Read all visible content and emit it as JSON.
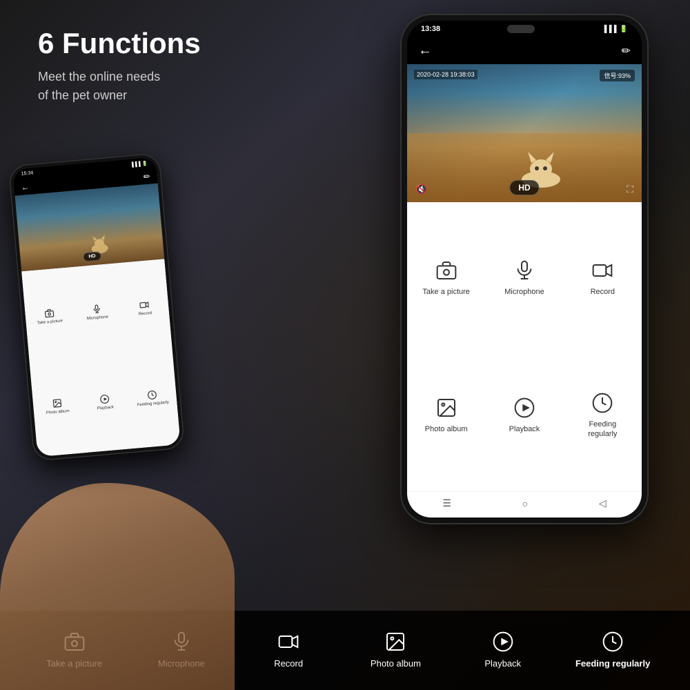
{
  "page": {
    "title": "6 Functions",
    "subtitle_line1": "Meet the online needs",
    "subtitle_line2": "of the pet owner"
  },
  "phone_large": {
    "status_time": "13:38",
    "status_signal": "信号:93%",
    "timestamp": "2020-02-28 19:38:03",
    "hd_badge": "HD",
    "functions": [
      {
        "label": "Take a picture",
        "icon": "camera"
      },
      {
        "label": "Microphone",
        "icon": "mic"
      },
      {
        "label": "Record",
        "icon": "video"
      },
      {
        "label": "Photo album",
        "icon": "photo"
      },
      {
        "label": "Playback",
        "icon": "play"
      },
      {
        "label": "Feeding regularly",
        "icon": "clock"
      }
    ]
  },
  "phone_small": {
    "hd_badge": "HD",
    "functions": [
      {
        "label": "Take a picture",
        "icon": "camera"
      },
      {
        "label": "Microphone",
        "icon": "mic"
      },
      {
        "label": "Record",
        "icon": "video"
      },
      {
        "label": "Photo album",
        "icon": "photo"
      },
      {
        "label": "Playback",
        "icon": "play"
      },
      {
        "label": "Feeding regularly",
        "icon": "clock"
      }
    ]
  },
  "bottom_bar": {
    "items": [
      {
        "label": "Take a picture",
        "icon": "camera",
        "bold": false
      },
      {
        "label": "Microphone",
        "icon": "mic",
        "bold": false
      },
      {
        "label": "Record",
        "icon": "video",
        "bold": false
      },
      {
        "label": "Photo album",
        "icon": "photo",
        "bold": false
      },
      {
        "label": "Playback",
        "icon": "play",
        "bold": false
      },
      {
        "label": "Feeding regularly",
        "icon": "clock",
        "bold": true
      }
    ]
  }
}
